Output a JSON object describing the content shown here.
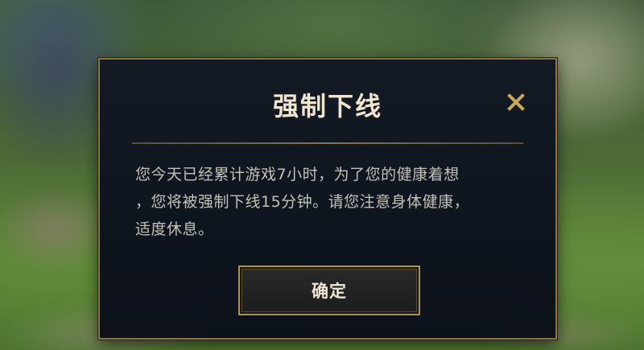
{
  "dialog": {
    "title": "强制下线",
    "message_lines": [
      "您今天已经累计游戏7小时，为了您的健康着想",
      "，您将被强制下线15分钟。请您注意身体健康，",
      "适度休息。"
    ],
    "confirm_label": "确定",
    "close_icon": "close-icon"
  },
  "colors": {
    "accent_gold": "#c9a85c",
    "border_gold": "#8a7446",
    "panel_bg": "#141a24",
    "title_text": "#f0e6cf",
    "body_text": "#c4c1b7"
  }
}
